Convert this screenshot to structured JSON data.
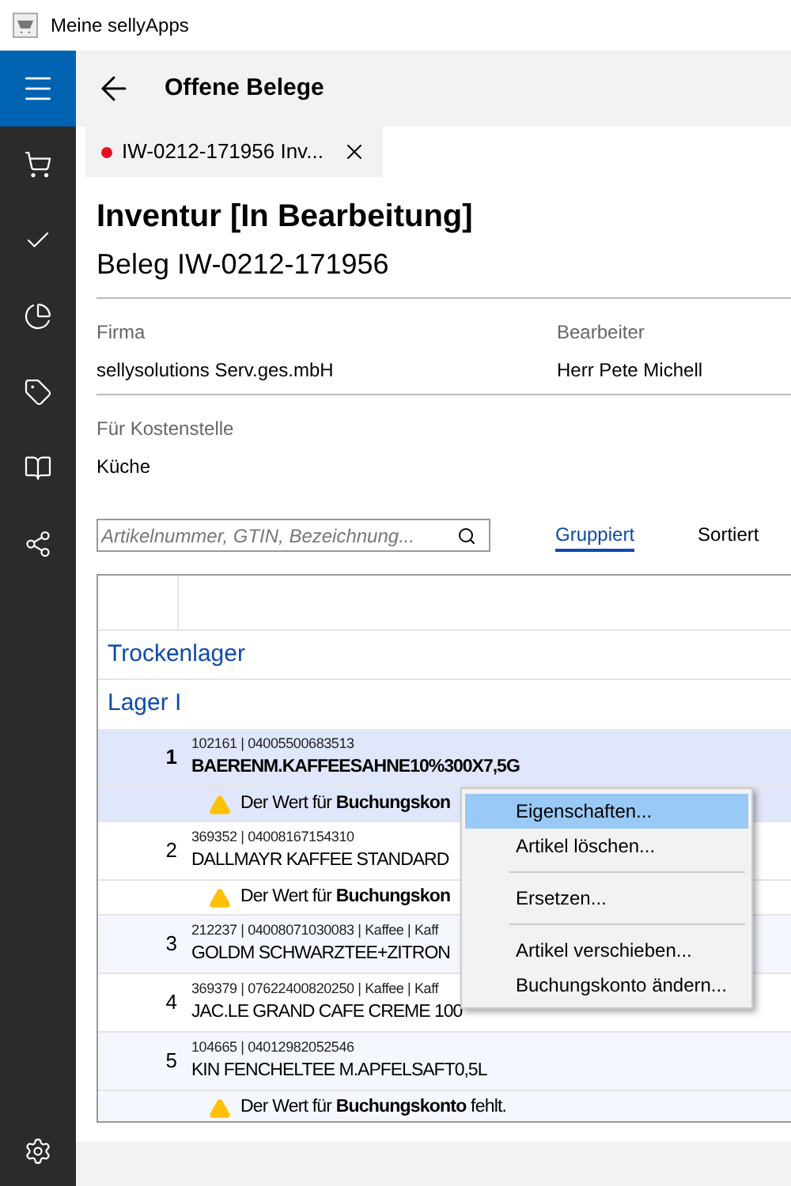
{
  "title_bar": {
    "title": "Meine sellyApps"
  },
  "header": {
    "title": "Offene Belege"
  },
  "tabs": [
    {
      "label": "IW-0212-171956 Inv...",
      "selected": true,
      "unsaved": true
    }
  ],
  "document": {
    "title": "Inventur [In Bearbeitung]",
    "subtitle": "Beleg IW-0212-171956"
  },
  "field_rows": [
    [
      {
        "label": "Firma",
        "value": "sellysolutions Serv.ges.mbH"
      },
      {
        "label": "Bearbeiter",
        "value": "Herr Pete Michell"
      }
    ],
    [
      {
        "label": "Für Kostenstelle",
        "value": "Küche"
      }
    ]
  ],
  "search": {
    "placeholder": "Artikelnummer, GTIN, Bezeichnung..."
  },
  "view_toggles": [
    {
      "label": "Gruppiert",
      "selected": true
    },
    {
      "label": "Sortiert",
      "selected": false
    }
  ],
  "table": {
    "groups": [
      {
        "title": "Trockenlager",
        "children": [
          {
            "title": "Lager I",
            "rows": [
              {
                "number": "1",
                "meta": "102161 | 04005500683513",
                "name": "BAERENM.KAFFEESAHNE10%300X7,5G",
                "warning": "Der Wert für **Buchungskon**",
                "selected": true
              },
              {
                "number": "2",
                "meta": "369352 | 04008167154310",
                "name": "DALLMAYR KAFFEE STANDARD",
                "warning": "Der Wert für **Buchungskon**",
                "selected": false
              },
              {
                "number": "3",
                "meta": "212237 | 04008071030083 | Kaffee | Kaff",
                "name": "GOLDM SCHWARZTEE+ZITRON",
                "selected": false
              },
              {
                "number": "4",
                "meta": "369379 | 07622400820250 | Kaffee | Kaff",
                "name": "JAC.LE GRAND CAFE CREME 100",
                "selected": false
              },
              {
                "number": "5",
                "meta": "104665 | 04012982052546",
                "name": "KIN FENCHELTEE M.APFELSAFT0,5L",
                "warning": "Der Wert für **Buchungskonto** fehlt.",
                "selected": false
              }
            ]
          }
        ]
      }
    ]
  },
  "context_menu": [
    {
      "kind": "item",
      "label": "Eigenschaften...",
      "selected": true
    },
    {
      "kind": "item",
      "label": "Artikel löschen...",
      "selected": false
    },
    {
      "kind": "separator"
    },
    {
      "kind": "item",
      "label": "Ersetzen...",
      "selected": false
    },
    {
      "kind": "separator"
    },
    {
      "kind": "item",
      "label": "Artikel verschieben...",
      "selected": false
    },
    {
      "kind": "item",
      "label": "Buchungskonto ändern...",
      "selected": false
    }
  ]
}
